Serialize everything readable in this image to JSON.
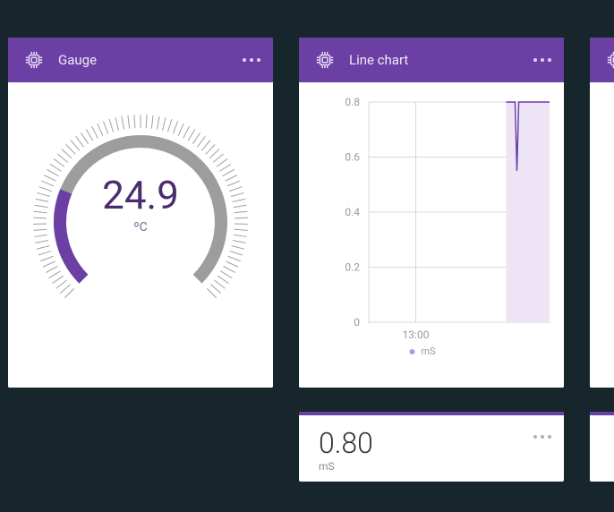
{
  "cards": {
    "gauge": {
      "title": "Gauge",
      "value": "24.9",
      "unit": "ºC",
      "min": 0,
      "max": 100,
      "fill_fraction": 0.249
    },
    "line": {
      "title": "Line chart",
      "legend": "mS",
      "x_tick": "13:00",
      "y_ticks": [
        "0",
        "0.2",
        "0.4",
        "0.6",
        "0.8"
      ]
    },
    "value": {
      "value": "0.80",
      "unit": "mS"
    }
  },
  "chart_data": {
    "type": "line",
    "title": "Line chart",
    "xlabel": "",
    "ylabel": "",
    "ylim": [
      0,
      0.8
    ],
    "x": [
      "13:00"
    ],
    "series": [
      {
        "name": "mS",
        "values": [
          0.8
        ]
      }
    ],
    "annotations": []
  },
  "colors": {
    "accent": "#6c3fa4",
    "gauge_track": "#9d9d9d",
    "gauge_fill": "#6c3fa4",
    "area_fill": "#ede4f6",
    "grid": "#d8d8d8",
    "axis_text": "#9a9a9a"
  }
}
